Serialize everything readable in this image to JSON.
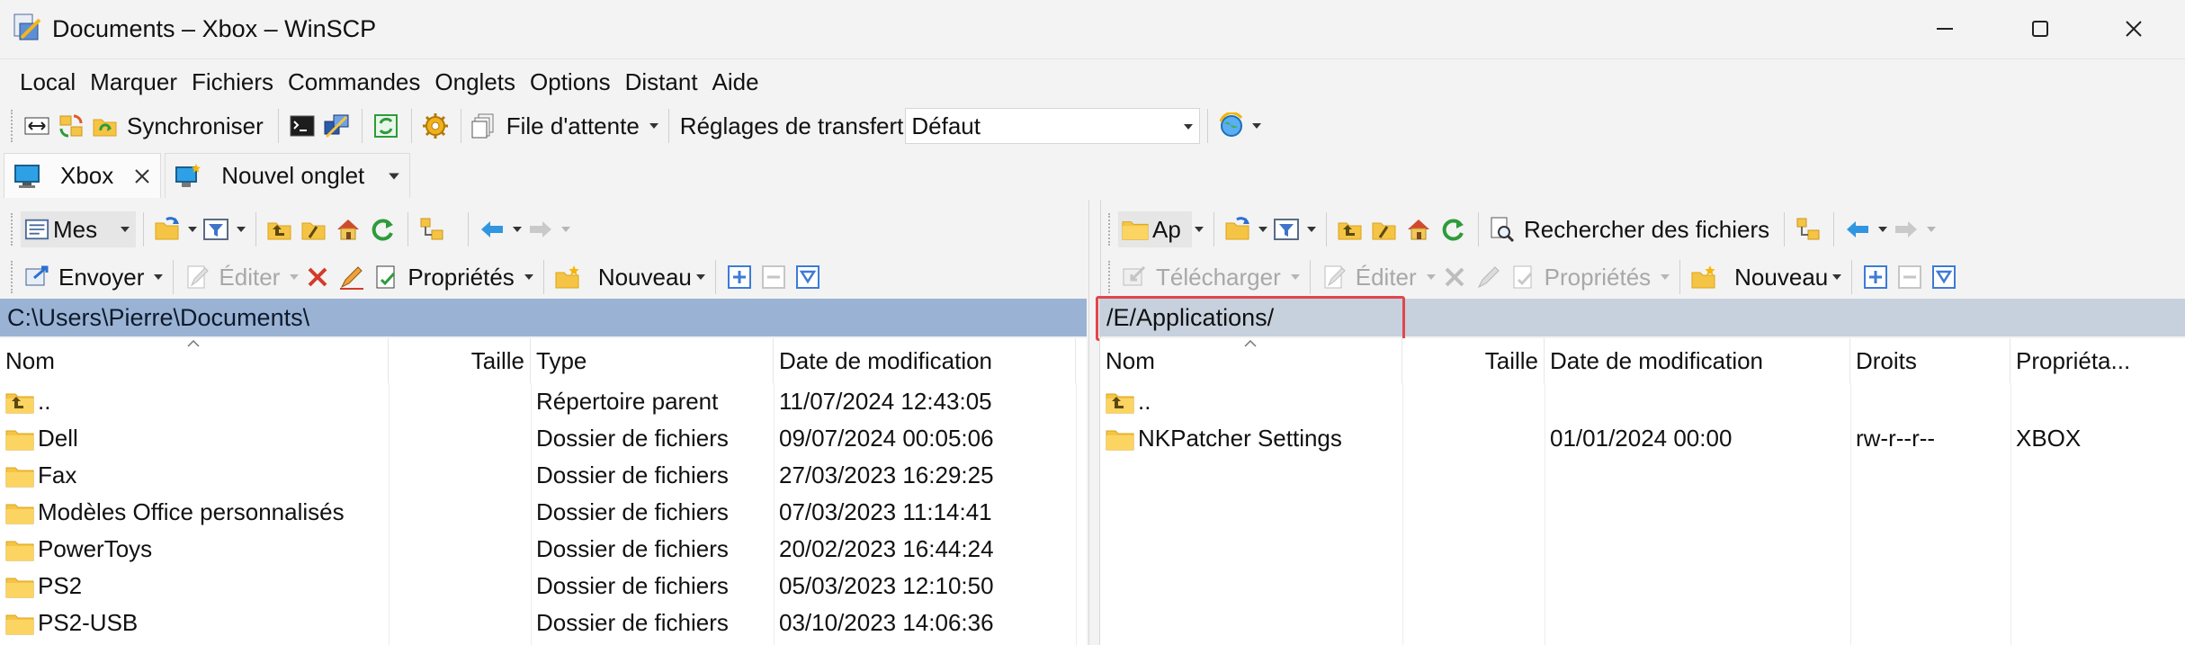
{
  "window": {
    "title": "Documents – Xbox – WinSCP",
    "icon": "winscp-app-icon",
    "controls": [
      "minimize-icon",
      "maximize-icon",
      "close-icon"
    ]
  },
  "menu": [
    "Local",
    "Marquer",
    "Fichiers",
    "Commandes",
    "Onglets",
    "Options",
    "Distant",
    "Aide"
  ],
  "toolbar": {
    "synchronize_label": "Synchroniser",
    "queue_label": "File d'attente",
    "transfer_settings_label": "Réglages de transfert",
    "transfer_preset": "Défaut"
  },
  "tabs": [
    {
      "label": "Xbox",
      "active": true
    },
    {
      "label": "Nouvel onglet",
      "active": false
    }
  ],
  "left_panel": {
    "location_combo": "Mes",
    "actions": {
      "send": "Envoyer",
      "edit": "Éditer",
      "properties": "Propriétés",
      "new": "Nouveau"
    },
    "path": "C:\\Users\\Pierre\\Documents\\",
    "columns": [
      "Nom",
      "Taille",
      "Type",
      "Date de modification"
    ],
    "rows": [
      {
        "name": "..",
        "size": "",
        "type": "Répertoire parent",
        "modified": "11/07/2024 12:43:05",
        "icon": "parent-folder-icon"
      },
      {
        "name": "Dell",
        "size": "",
        "type": "Dossier de fichiers",
        "modified": "09/07/2024 00:05:06",
        "icon": "folder-icon"
      },
      {
        "name": "Fax",
        "size": "",
        "type": "Dossier de fichiers",
        "modified": "27/03/2023 16:29:25",
        "icon": "folder-icon"
      },
      {
        "name": "Modèles Office personnalisés",
        "size": "",
        "type": "Dossier de fichiers",
        "modified": "07/03/2023 11:14:41",
        "icon": "folder-icon"
      },
      {
        "name": "PowerToys",
        "size": "",
        "type": "Dossier de fichiers",
        "modified": "20/02/2023 16:44:24",
        "icon": "folder-icon"
      },
      {
        "name": "PS2",
        "size": "",
        "type": "Dossier de fichiers",
        "modified": "05/03/2023 12:10:50",
        "icon": "folder-icon"
      },
      {
        "name": "PS2-USB",
        "size": "",
        "type": "Dossier de fichiers",
        "modified": "03/10/2023 14:06:36",
        "icon": "folder-icon"
      }
    ]
  },
  "right_panel": {
    "location_combo": "Ap",
    "search_label": "Rechercher des fichiers",
    "actions": {
      "download": "Télécharger",
      "edit": "Éditer",
      "properties": "Propriétés",
      "new": "Nouveau"
    },
    "path": "/E/Applications/",
    "columns": [
      "Nom",
      "Taille",
      "Date de modification",
      "Droits",
      "Propriéta..."
    ],
    "rows": [
      {
        "name": "..",
        "size": "",
        "modified": "",
        "rights": "",
        "owner": "",
        "icon": "parent-folder-icon"
      },
      {
        "name": "NKPatcher Settings",
        "size": "",
        "modified": "01/01/2024 00:00",
        "rights": "rw-r--r--",
        "owner": "XBOX",
        "icon": "folder-icon"
      }
    ]
  },
  "colors": {
    "local_path_bg": "#9ab3d4",
    "remote_path_bg": "#c7d1de",
    "highlight_border": "#e0474c",
    "folder_yellow": "#f6c445"
  }
}
